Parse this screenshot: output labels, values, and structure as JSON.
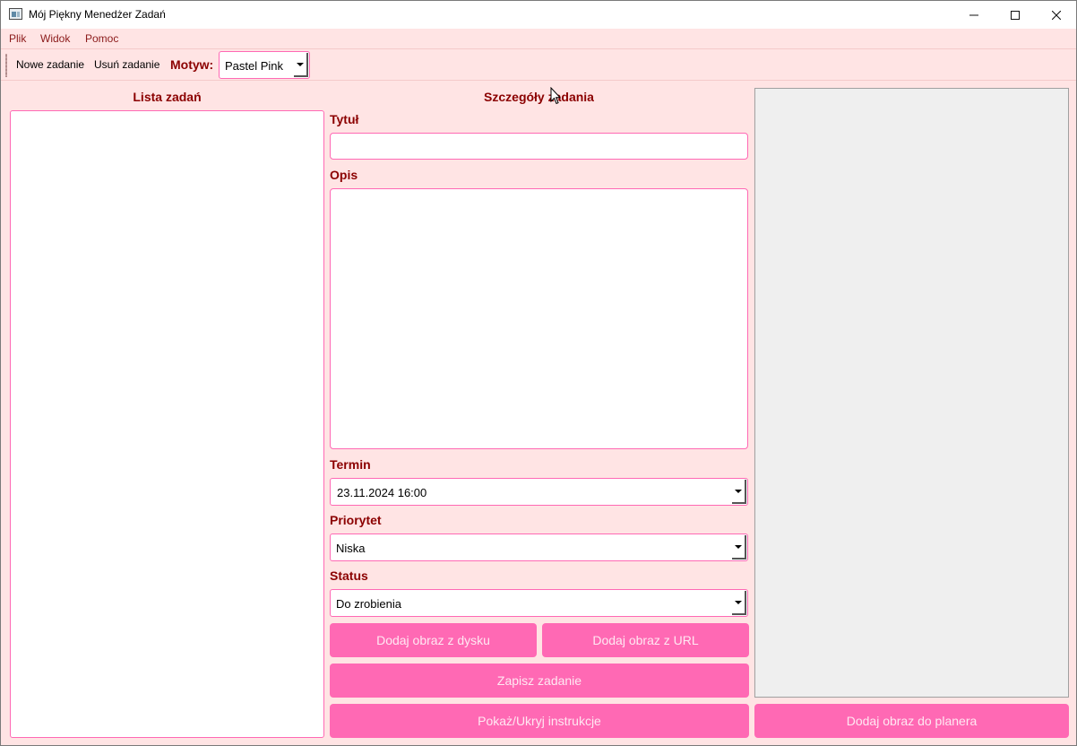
{
  "window": {
    "title": "Mój Piękny Menedżer Zadań"
  },
  "menu": {
    "items": [
      "Plik",
      "Widok",
      "Pomoc"
    ]
  },
  "toolbar": {
    "new_task": "Nowe zadanie",
    "delete_task": "Usuń zadanie",
    "theme_label": "Motyw:",
    "theme_value": "Pastel Pink"
  },
  "task_list": {
    "title": "Lista zadań"
  },
  "details": {
    "title": "Szczegóły zadania",
    "title_label": "Tytuł",
    "title_value": "",
    "description_label": "Opis",
    "description_value": "",
    "deadline_label": "Termin",
    "deadline_value": "23.11.2024 16:00",
    "priority_label": "Priorytet",
    "priority_value": "Niska",
    "status_label": "Status",
    "status_value": "Do zrobienia"
  },
  "buttons": {
    "add_image_disk": "Dodaj obraz z dysku",
    "add_image_url": "Dodaj obraz z URL",
    "save_task": "Zapisz zadanie",
    "toggle_instructions": "Pokaż/Ukryj instrukcje",
    "add_image_planner": "Dodaj obraz do planera"
  },
  "colors": {
    "background": "#ffe4e4",
    "accent": "#ff69b4",
    "label": "#8b0000",
    "image_panel": "#efefef"
  }
}
